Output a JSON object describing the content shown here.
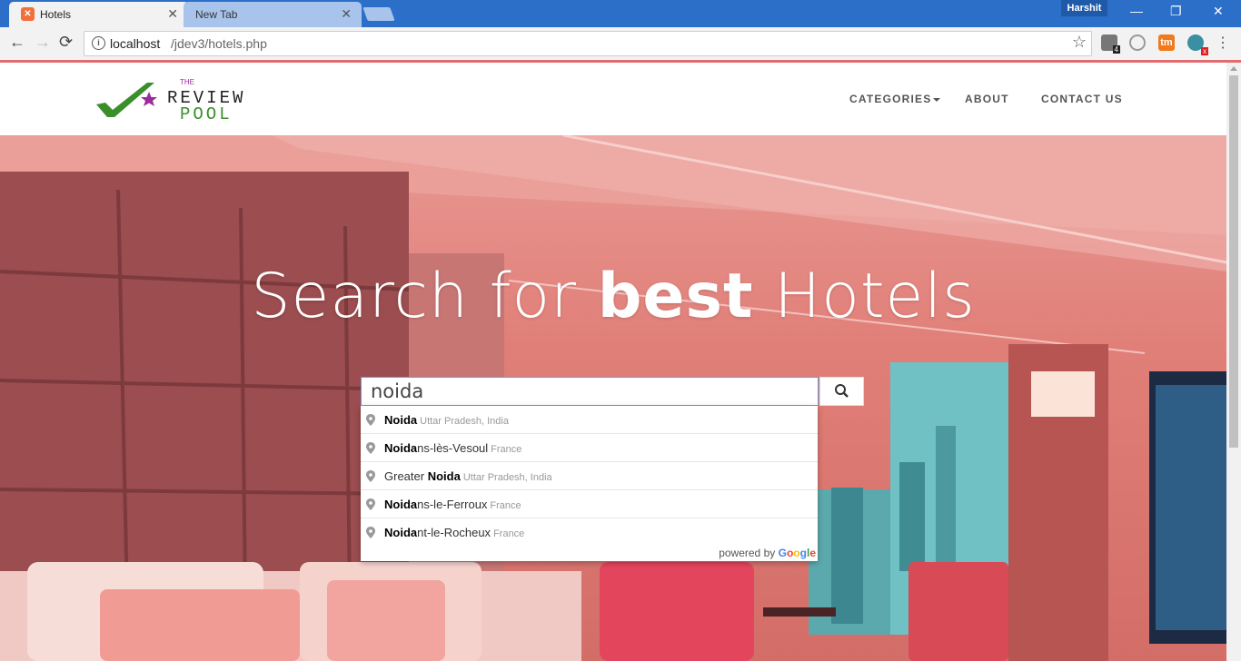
{
  "browser": {
    "tabs": [
      {
        "title": "Hotels",
        "active": true
      },
      {
        "title": "New Tab",
        "active": false
      }
    ],
    "profile_name": "Harshit",
    "url_host": "localhost",
    "url_path": "/jdev3/hotels.php",
    "close_glyph": "✕",
    "window_controls": {
      "minimize": "—",
      "restore": "❐",
      "close": "✕"
    },
    "extensions": [
      {
        "icon": "extension-badge-icon",
        "badge": "4"
      },
      {
        "icon": "vpn-extension-icon"
      },
      {
        "icon": "tm-extension-icon",
        "label": "tm"
      },
      {
        "icon": "chat-extension-icon"
      }
    ]
  },
  "site": {
    "logo": {
      "the": "THE",
      "review": "REVIEW",
      "pool": "POOL"
    },
    "nav": {
      "categories": "CATEGORIES",
      "about": "ABOUT",
      "contact": "CONTACT US"
    },
    "hero": {
      "title_pre": "Search for ",
      "title_bold": "best",
      "title_post": " Hotels"
    },
    "search": {
      "value": "noida",
      "button_icon": "search-icon"
    },
    "suggestions": [
      {
        "match": "Noida",
        "rest": "",
        "secondary": "Uttar Pradesh, India"
      },
      {
        "match": "Noida",
        "rest": "ns-lès-Vesoul",
        "secondary": "France"
      },
      {
        "prefix": "Greater ",
        "match": "Noida",
        "rest": "",
        "secondary": "Uttar Pradesh, India"
      },
      {
        "match": "Noida",
        "rest": "ns-le-Ferroux",
        "secondary": "France"
      },
      {
        "match": "Noida",
        "rest": "nt-le-Rocheux",
        "secondary": "France"
      }
    ],
    "powered_by": "powered by",
    "google": "Google"
  },
  "colors": {
    "chrome_blue": "#2b6fc9",
    "accent_red": "#e26b6f",
    "logo_green": "#3a8f2b",
    "logo_purple": "#9b2c9b"
  }
}
